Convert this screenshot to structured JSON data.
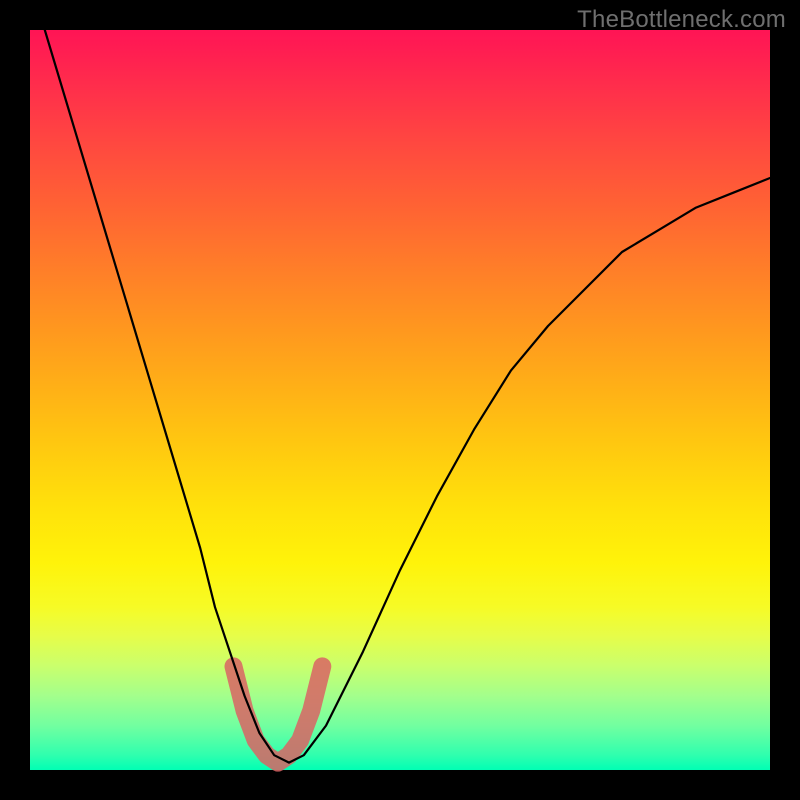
{
  "watermark": "TheBottleneck.com",
  "chart_data": {
    "type": "line",
    "title": "",
    "xlabel": "",
    "ylabel": "",
    "xlim": [
      0,
      100
    ],
    "ylim": [
      0,
      100
    ],
    "grid": false,
    "legend": false,
    "background_gradient": {
      "top": "#ff1455",
      "bottom": "#00ffb4"
    },
    "series": [
      {
        "name": "bottleneck-curve",
        "color": "#000000",
        "x": [
          2,
          5,
          8,
          11,
          14,
          17,
          20,
          23,
          25,
          27,
          29,
          31,
          33,
          35,
          37,
          40,
          45,
          50,
          55,
          60,
          65,
          70,
          75,
          80,
          85,
          90,
          95,
          100
        ],
        "y": [
          100,
          90,
          80,
          70,
          60,
          50,
          40,
          30,
          22,
          16,
          10,
          5,
          2,
          1,
          2,
          6,
          16,
          27,
          37,
          46,
          54,
          60,
          65,
          70,
          73,
          76,
          78,
          80
        ]
      }
    ],
    "highlight_range": {
      "description": "optimal-region",
      "color": "#d96464",
      "x": [
        27.5,
        29,
        30.5,
        32,
        33.5,
        35,
        36.5,
        38,
        39.5
      ],
      "y": [
        14,
        8,
        4,
        2,
        1,
        2,
        4,
        8,
        14
      ]
    }
  }
}
